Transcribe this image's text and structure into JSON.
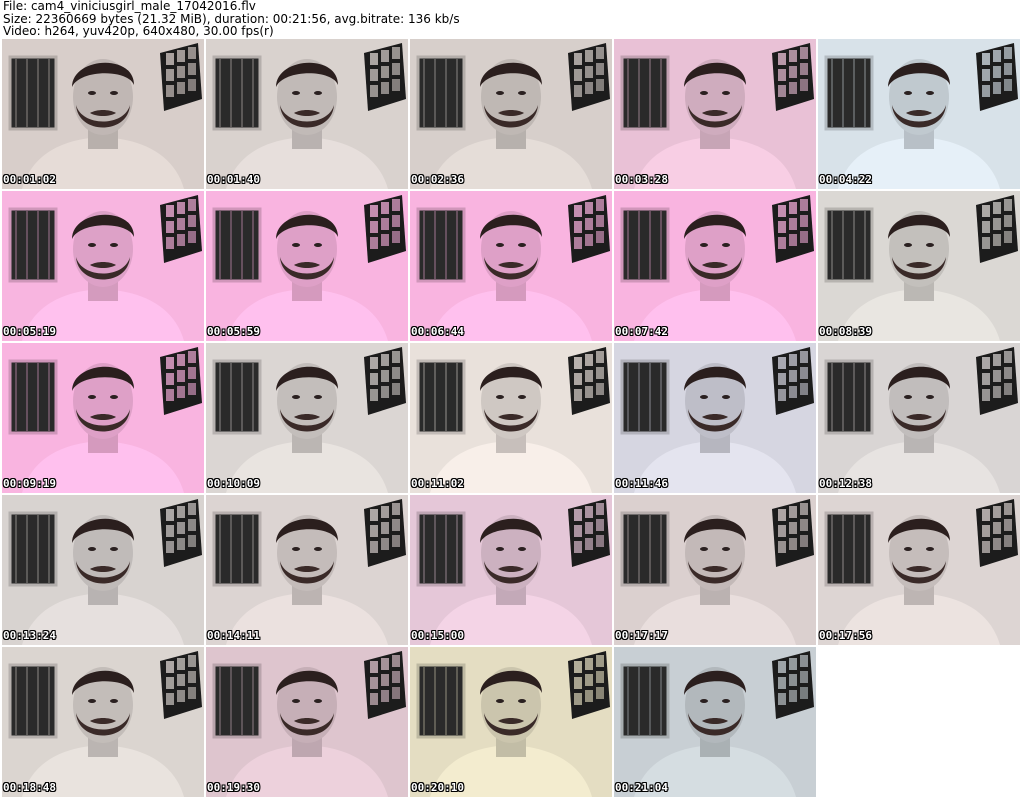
{
  "header": {
    "file_line": "File: cam4_viniciusgirl_male_17042016.flv",
    "size_line": "Size: 22360669 bytes (21.32 MiB), duration: 00:21:56, avg.bitrate: 136 kb/s",
    "video_line": "Video: h264, yuv420p, 640x480, 30.00 fps(r)"
  },
  "thumbnails": [
    {
      "time": "00:01:02",
      "tint": "#c8bfbb"
    },
    {
      "time": "00:01:40",
      "tint": "#c9c2bf"
    },
    {
      "time": "00:02:36",
      "tint": "#c7c0bc"
    },
    {
      "time": "00:03:28",
      "tint": "#d8b3c6"
    },
    {
      "time": "00:04:22",
      "tint": "#c8d1d8"
    },
    {
      "time": "00:05:19",
      "tint": "#e6a8cf"
    },
    {
      "time": "00:05:59",
      "tint": "#e7a7cf"
    },
    {
      "time": "00:06:44",
      "tint": "#e7a7cf"
    },
    {
      "time": "00:07:42",
      "tint": "#e7a7cf"
    },
    {
      "time": "00:08:39",
      "tint": "#cbc8c4"
    },
    {
      "time": "00:09:19",
      "tint": "#e7a7cf"
    },
    {
      "time": "00:10:09",
      "tint": "#cbc6c3"
    },
    {
      "time": "00:11:02",
      "tint": "#d8d0cb"
    },
    {
      "time": "00:11:46",
      "tint": "#c6c6d0"
    },
    {
      "time": "00:12:38",
      "tint": "#c9c5c4"
    },
    {
      "time": "00:13:24",
      "tint": "#c8c3c1"
    },
    {
      "time": "00:14:11",
      "tint": "#ccc4c2"
    },
    {
      "time": "00:15:00",
      "tint": "#d4b8c8"
    },
    {
      "time": "00:17:17",
      "tint": "#cbc1c0"
    },
    {
      "time": "00:17:56",
      "tint": "#cdc5c3"
    },
    {
      "time": "00:18:48",
      "tint": "#cbc5c1"
    },
    {
      "time": "00:19:30",
      "tint": "#ceb6bf"
    },
    {
      "time": "00:20:10",
      "tint": "#d3cdb4"
    },
    {
      "time": "00:21:04",
      "tint": "#b9c0c4"
    }
  ],
  "colors": {
    "timestamp_text": "#ffffff",
    "timestamp_outline": "#000000",
    "page_background": "#ffffff"
  }
}
